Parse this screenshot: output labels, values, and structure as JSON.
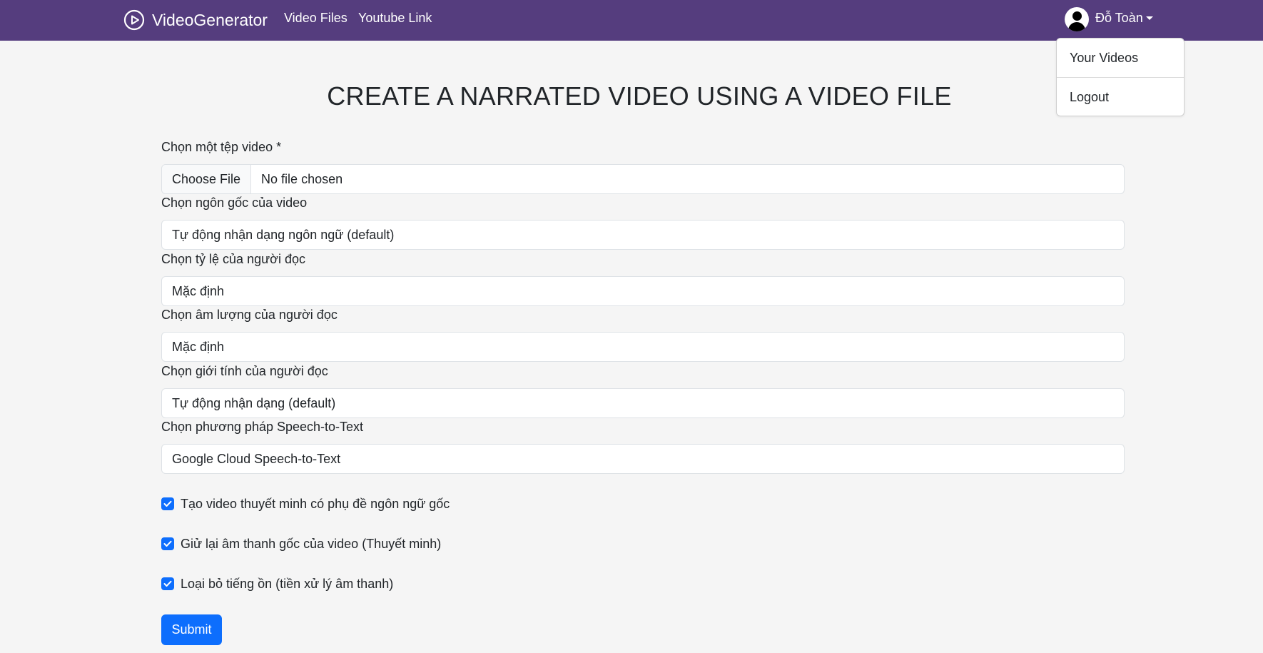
{
  "navbar": {
    "brand": "VideoGenerator",
    "links": [
      "Video Files",
      "Youtube Link"
    ],
    "user_name": "Đỗ Toàn",
    "colors": {
      "background": "#553d7e"
    }
  },
  "user_menu": {
    "items": [
      "Your Videos",
      "Logout"
    ]
  },
  "page": {
    "title": "CREATE A NARRATED VIDEO USING A VIDEO FILE"
  },
  "form": {
    "file_label": "Chọn một tệp video *",
    "file_button": "Choose File",
    "file_status": "No file chosen",
    "fields": [
      {
        "label": "Chọn ngôn gốc của video",
        "value": "Tự động nhận dạng ngôn ngữ (default)"
      },
      {
        "label": "Chọn tỷ lệ của người đọc",
        "value": "Mặc định"
      },
      {
        "label": "Chọn âm lượng của người đọc",
        "value": "Mặc định"
      },
      {
        "label": "Chọn giới tính của người đọc",
        "value": "Tự động nhận dạng (default)"
      },
      {
        "label": "Chọn phương pháp Speech-to-Text",
        "value": "Google Cloud Speech-to-Text"
      }
    ],
    "checkboxes": [
      {
        "label": "Tạo video thuyết minh có phụ đề ngôn ngữ gốc",
        "checked": true
      },
      {
        "label": "Giử lại âm thanh gốc của video (Thuyết minh)",
        "checked": true
      },
      {
        "label": "Loại bỏ tiếng ồn (tiền xử lý âm thanh)",
        "checked": true
      }
    ],
    "submit_label": "Submit",
    "colors": {
      "accent": "#0d6efd"
    }
  },
  "icons": {
    "brand": "play-circle-icon",
    "user": "user-avatar-icon",
    "caret": "caret-down-icon",
    "check": "check-icon"
  }
}
